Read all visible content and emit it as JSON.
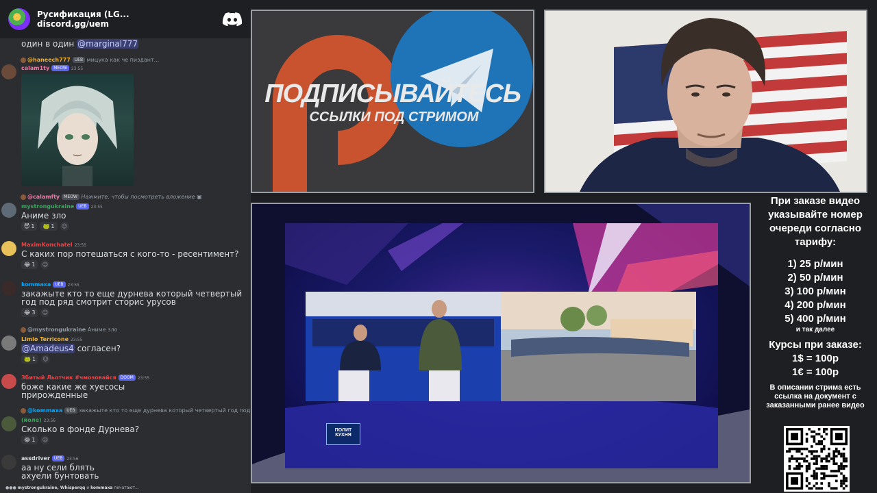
{
  "chat": {
    "server_name": "Русификация (LG...",
    "server_link": "discord.gg/uem",
    "top_partial": {
      "text": "один в один ",
      "mention": "@marginal777"
    },
    "messages": [
      {
        "reply_name": "@haneech777",
        "reply_badge": "UEB",
        "reply_text": "мицука как че пиздант...",
        "author": "calam1ty",
        "author_color": "#f27aa8",
        "badge": "MEOW",
        "time": "23:55",
        "avatar_color": "#6b4a3a",
        "has_image": true
      },
      {
        "reply_name": "@calamfty",
        "reply_badge": "MEOW",
        "reply_text": "Нажмите, чтобы посмотреть вложение",
        "author": "mystrongukraine",
        "author_color": "#3ba55d",
        "badge": "UEB",
        "time": "23:55",
        "avatar_color": "#5e6a75",
        "text": "Аниме зло",
        "reactions": [
          {
            "emoji": "😈",
            "count": "1"
          },
          {
            "emoji": "🐸",
            "count": "1"
          }
        ]
      },
      {
        "author": "MaximKonchatel",
        "author_color": "#ed4245",
        "time": "23:55",
        "avatar_color": "#e8c15a",
        "text": "С каких пор потешаться с кого-то - ресентимент?",
        "reactions": [
          {
            "emoji": "😂",
            "count": "1"
          }
        ]
      },
      {
        "author": "kommaxa",
        "author_color": "#00a8fc",
        "badge": "UEB",
        "time": "23:55",
        "avatar_color": "#3a2a2a",
        "text": "закажыте кто то еще дурнева который четвертый год под ряд смотрит сторис урусов",
        "reactions": [
          {
            "emoji": "😂",
            "count": "3"
          }
        ]
      },
      {
        "reply_name": "@mystrongukraine",
        "reply_text": "Аниме зло",
        "author": "Limio Terricone",
        "author_color": "#f0b232",
        "time": "23:55",
        "avatar_color": "#7a7a7a",
        "mention": "@Amadeus4",
        "text": " согласен?",
        "reactions": [
          {
            "emoji": "🐸",
            "count": "1"
          }
        ]
      },
      {
        "author": "Збитый Льотчик #чмозовайся",
        "author_color": "#ed4245",
        "badge": "DOOM",
        "time": "23:55",
        "avatar_color": "#c94a4a",
        "text": "боже какие же хуесосы прирожденные"
      },
      {
        "reply_name": "@kommaxa",
        "reply_badge": "UEB",
        "reply_text": "закажыте кто то еще дурнева который четвертый год под ряд смотрит стори",
        "author": "(йоле)",
        "author_color": "#3ba55d",
        "time": "23:56",
        "avatar_color": "#4a5a3a",
        "text": "Сколько в фонде Дурнева?",
        "reactions": [
          {
            "emoji": "😂",
            "count": "1"
          }
        ]
      },
      {
        "author": "assdriver",
        "author_color": "#dbdee1",
        "badge": "UEB",
        "time": "23:56",
        "avatar_color": "#3a3a3a",
        "text": "аа ну сели блять ахуели бунтовать"
      }
    ],
    "typing": {
      "users": "mystrongukraine, Whisperqq",
      "conj": " и ",
      "last": "kommaxa",
      "suffix": " печатают..."
    }
  },
  "promo": {
    "title": "ПОДПИСЫВАЙТЕСЬ",
    "subtitle": "ССЫЛКИ ПОД СТРИМОМ"
  },
  "video": {
    "logo_line1": "ПОЛИТ",
    "logo_line2": "КУХНЯ"
  },
  "info": {
    "intro": "При заказе видео указывайте номер очереди согласно тарифу:",
    "tariffs": [
      "1) 25 р/мин",
      "2) 50 р/мин",
      "3) 100 р/мин",
      "4) 200 р/мин",
      "5) 400 р/мин"
    ],
    "etc": "и так далее",
    "rates_title": "Курсы при заказе:",
    "rates": [
      "1$ = 100р",
      "1€ = 100р"
    ],
    "outro": "В описании стрима есть ссылка на документ с заказанными ранее видео"
  }
}
